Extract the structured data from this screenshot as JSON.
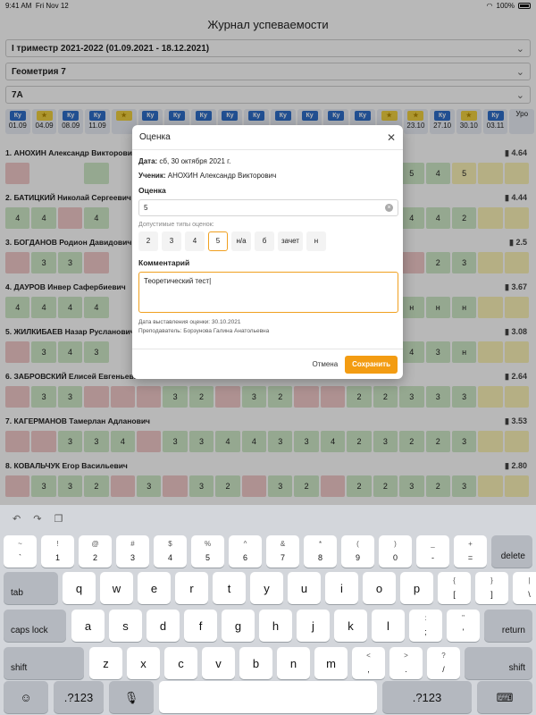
{
  "status": {
    "time": "9:41 AM",
    "date": "Fri Nov 12",
    "battery": "100%"
  },
  "header": {
    "title": "Журнал успеваемости"
  },
  "filters": {
    "term": "I триместр 2021-2022 (01.09.2021 - 18.12.2021)",
    "subject": "Геометрия 7",
    "class": "7А"
  },
  "dates": [
    {
      "tag": "Ку",
      "star": false,
      "label": "01.09"
    },
    {
      "tag": "★",
      "star": true,
      "label": "04.09"
    },
    {
      "tag": "Ку",
      "star": false,
      "label": "08.09"
    },
    {
      "tag": "Ку",
      "star": false,
      "label": "11.09"
    },
    {
      "tag": "★",
      "star": true,
      "label": ""
    },
    {
      "tag": "Ку",
      "star": false,
      "label": ""
    },
    {
      "tag": "Ку",
      "star": false,
      "label": ""
    },
    {
      "tag": "Ку",
      "star": false,
      "label": ""
    },
    {
      "tag": "Ку",
      "star": false,
      "label": ""
    },
    {
      "tag": "Ку",
      "star": false,
      "label": ""
    },
    {
      "tag": "Ку",
      "star": false,
      "label": ""
    },
    {
      "tag": "Ку",
      "star": false,
      "label": ""
    },
    {
      "tag": "Ку",
      "star": false,
      "label": ""
    },
    {
      "tag": "Ку",
      "star": false,
      "label": ""
    },
    {
      "tag": "★",
      "star": true,
      "label": ""
    },
    {
      "tag": "★",
      "star": true,
      "label": "23.10"
    },
    {
      "tag": "Ку",
      "star": false,
      "label": "27.10"
    },
    {
      "tag": "★",
      "star": true,
      "label": "30.10"
    },
    {
      "tag": "Ку",
      "star": false,
      "label": "03.11"
    },
    {
      "tag": "",
      "star": false,
      "label": "Уро"
    }
  ],
  "students": [
    {
      "name": "1. АНОХИН Александр Викторович",
      "avg": "4.64",
      "cells": [
        [
          "r",
          ""
        ],
        [
          "o",
          ""
        ],
        [
          "o",
          ""
        ],
        [
          "g",
          ""
        ],
        [
          "o",
          ""
        ],
        [
          "o",
          ""
        ],
        [
          "o",
          ""
        ],
        [
          "o",
          ""
        ],
        [
          "o",
          ""
        ],
        [
          "o",
          ""
        ],
        [
          "o",
          ""
        ],
        [
          "o",
          ""
        ],
        [
          "o",
          ""
        ],
        [
          "o",
          ""
        ],
        [
          "g",
          ""
        ],
        [
          "g",
          "5"
        ],
        [
          "g",
          "4"
        ],
        [
          "y",
          "5"
        ],
        [
          "y",
          ""
        ],
        [
          "y",
          ""
        ]
      ]
    },
    {
      "name": "2. БАТИЦКИЙ Николай Сергеевич",
      "avg": "4.44",
      "cells": [
        [
          "g",
          "4"
        ],
        [
          "g",
          "4"
        ],
        [
          "r",
          ""
        ],
        [
          "g",
          "4"
        ],
        [
          "o",
          ""
        ],
        [
          "o",
          ""
        ],
        [
          "o",
          ""
        ],
        [
          "o",
          ""
        ],
        [
          "o",
          ""
        ],
        [
          "o",
          ""
        ],
        [
          "o",
          ""
        ],
        [
          "o",
          ""
        ],
        [
          "o",
          ""
        ],
        [
          "o",
          ""
        ],
        [
          "g",
          ""
        ],
        [
          "g",
          "4"
        ],
        [
          "g",
          "4"
        ],
        [
          "g",
          "2"
        ],
        [
          "y",
          ""
        ],
        [
          "y",
          ""
        ]
      ]
    },
    {
      "name": "3. БОГДАНОВ Родион Давидович",
      "avg": "2.5",
      "cells": [
        [
          "r",
          ""
        ],
        [
          "g",
          "3"
        ],
        [
          "g",
          "3"
        ],
        [
          "r",
          ""
        ],
        [
          "o",
          ""
        ],
        [
          "o",
          ""
        ],
        [
          "o",
          ""
        ],
        [
          "o",
          ""
        ],
        [
          "o",
          ""
        ],
        [
          "o",
          ""
        ],
        [
          "o",
          ""
        ],
        [
          "o",
          ""
        ],
        [
          "o",
          ""
        ],
        [
          "o",
          ""
        ],
        [
          "g",
          ""
        ],
        [
          "r",
          ""
        ],
        [
          "g",
          "2"
        ],
        [
          "g",
          "3"
        ],
        [
          "y",
          ""
        ],
        [
          "y",
          ""
        ]
      ]
    },
    {
      "name": "4. ДАУРОВ Инвер Сафербиевич",
      "avg": "3.67",
      "cells": [
        [
          "g",
          "4"
        ],
        [
          "g",
          "4"
        ],
        [
          "g",
          "4"
        ],
        [
          "g",
          "4"
        ],
        [
          "o",
          ""
        ],
        [
          "o",
          ""
        ],
        [
          "o",
          ""
        ],
        [
          "o",
          ""
        ],
        [
          "o",
          ""
        ],
        [
          "o",
          ""
        ],
        [
          "o",
          ""
        ],
        [
          "o",
          ""
        ],
        [
          "o",
          ""
        ],
        [
          "o",
          ""
        ],
        [
          "g",
          ""
        ],
        [
          "g",
          "н"
        ],
        [
          "g",
          "н"
        ],
        [
          "g",
          "н"
        ],
        [
          "y",
          ""
        ],
        [
          "y",
          ""
        ]
      ]
    },
    {
      "name": "5. ЖИЛКИБАЕВ Назар Русланович",
      "avg": "3.08",
      "cells": [
        [
          "r",
          ""
        ],
        [
          "g",
          "3"
        ],
        [
          "g",
          "4"
        ],
        [
          "g",
          "3"
        ],
        [
          "o",
          ""
        ],
        [
          "o",
          ""
        ],
        [
          "o",
          ""
        ],
        [
          "o",
          ""
        ],
        [
          "o",
          ""
        ],
        [
          "o",
          ""
        ],
        [
          "o",
          ""
        ],
        [
          "o",
          ""
        ],
        [
          "o",
          ""
        ],
        [
          "o",
          ""
        ],
        [
          "g",
          ""
        ],
        [
          "g",
          "4"
        ],
        [
          "g",
          "3"
        ],
        [
          "g",
          "н"
        ],
        [
          "y",
          ""
        ],
        [
          "y",
          ""
        ]
      ]
    },
    {
      "name": "6. ЗАБРОВСКИЙ Елисей Евгеньевич",
      "avg": "2.64",
      "cells": [
        [
          "r",
          ""
        ],
        [
          "g",
          "3"
        ],
        [
          "g",
          "3"
        ],
        [
          "r",
          ""
        ],
        [
          "r",
          ""
        ],
        [
          "r",
          ""
        ],
        [
          "g",
          "3"
        ],
        [
          "g",
          "2"
        ],
        [
          "r",
          ""
        ],
        [
          "g",
          "3"
        ],
        [
          "g",
          "2"
        ],
        [
          "r",
          ""
        ],
        [
          "r",
          ""
        ],
        [
          "g",
          "2"
        ],
        [
          "g",
          "2"
        ],
        [
          "g",
          "3"
        ],
        [
          "g",
          "3"
        ],
        [
          "g",
          "3"
        ],
        [
          "y",
          ""
        ],
        [
          "y",
          ""
        ]
      ]
    },
    {
      "name": "7. КАГЕРМАНОВ Тамерлан Адланович",
      "avg": "3.53",
      "cells": [
        [
          "r",
          ""
        ],
        [
          "r",
          ""
        ],
        [
          "g",
          "3"
        ],
        [
          "g",
          "3"
        ],
        [
          "g",
          "4"
        ],
        [
          "r",
          ""
        ],
        [
          "g",
          "3"
        ],
        [
          "g",
          "3"
        ],
        [
          "g",
          "4"
        ],
        [
          "g",
          "4"
        ],
        [
          "g",
          "3"
        ],
        [
          "g",
          "3"
        ],
        [
          "g",
          "4"
        ],
        [
          "g",
          "2"
        ],
        [
          "g",
          "3"
        ],
        [
          "g",
          "2"
        ],
        [
          "g",
          "2"
        ],
        [
          "g",
          "3"
        ],
        [
          "y",
          ""
        ],
        [
          "y",
          ""
        ]
      ]
    },
    {
      "name": "8. КОВАЛЬЧУК Егор Васильевич",
      "avg": "2.80",
      "cells": [
        [
          "r",
          ""
        ],
        [
          "g",
          "3"
        ],
        [
          "g",
          "3"
        ],
        [
          "g",
          "2"
        ],
        [
          "r",
          ""
        ],
        [
          "g",
          "3"
        ],
        [
          "r",
          ""
        ],
        [
          "g",
          "3"
        ],
        [
          "g",
          "2"
        ],
        [
          "r",
          ""
        ],
        [
          "g",
          "3"
        ],
        [
          "g",
          "2"
        ],
        [
          "r",
          ""
        ],
        [
          "g",
          "2"
        ],
        [
          "g",
          "2"
        ],
        [
          "g",
          "3"
        ],
        [
          "g",
          "2"
        ],
        [
          "g",
          "3"
        ],
        [
          "y",
          ""
        ],
        [
          "y",
          ""
        ]
      ]
    }
  ],
  "modal": {
    "title": "Оценка",
    "date_label": "Дата:",
    "date_value": "сб, 30 октября 2021 г.",
    "student_label": "Ученик:",
    "student_value": "АНОХИН Александр Викторович",
    "grade_label": "Оценка",
    "grade_value": "5",
    "allowed_label": "Допустимые типы оценок:",
    "grade_types": [
      "2",
      "3",
      "4",
      "5",
      "н/а",
      "б",
      "зачет",
      "н"
    ],
    "selected_type": "5",
    "comment_label": "Комментарий",
    "comment_value": "Теоретический тест",
    "issued_date": "Дата выставления оценки: 30.10.2021",
    "teacher": "Преподаватель: Борзунова Галина Анатольевна",
    "cancel_label": "Отмена",
    "save_label": "Сохранить"
  },
  "keyboard": {
    "row1": [
      [
        "~",
        "`"
      ],
      [
        "!",
        "1"
      ],
      [
        "@",
        "2"
      ],
      [
        "#",
        "3"
      ],
      [
        "$",
        "4"
      ],
      [
        "%",
        "5"
      ],
      [
        "^",
        "6"
      ],
      [
        "&",
        "7"
      ],
      [
        "*",
        "8"
      ],
      [
        "(",
        "9"
      ],
      [
        ")",
        "0"
      ],
      [
        "_",
        "-"
      ],
      [
        "+",
        "="
      ]
    ],
    "delete": "delete",
    "tab": "tab",
    "row2": [
      "q",
      "w",
      "e",
      "r",
      "t",
      "y",
      "u",
      "i",
      "o",
      "p"
    ],
    "row2_extra": [
      [
        "{",
        "["
      ],
      [
        "}",
        "]"
      ],
      [
        "|",
        "\\"
      ]
    ],
    "caps": "caps lock",
    "row3": [
      "a",
      "s",
      "d",
      "f",
      "g",
      "h",
      "j",
      "k",
      "l"
    ],
    "row3_extra": [
      [
        ":",
        ";"
      ],
      [
        "\"",
        "'"
      ]
    ],
    "return": "return",
    "shift": "shift",
    "row4": [
      "z",
      "x",
      "c",
      "v",
      "b",
      "n",
      "m"
    ],
    "row4_extra": [
      [
        "<",
        ","
      ],
      [
        ">",
        "."
      ],
      [
        "?",
        "/"
      ]
    ],
    "numbers": ".?123"
  }
}
